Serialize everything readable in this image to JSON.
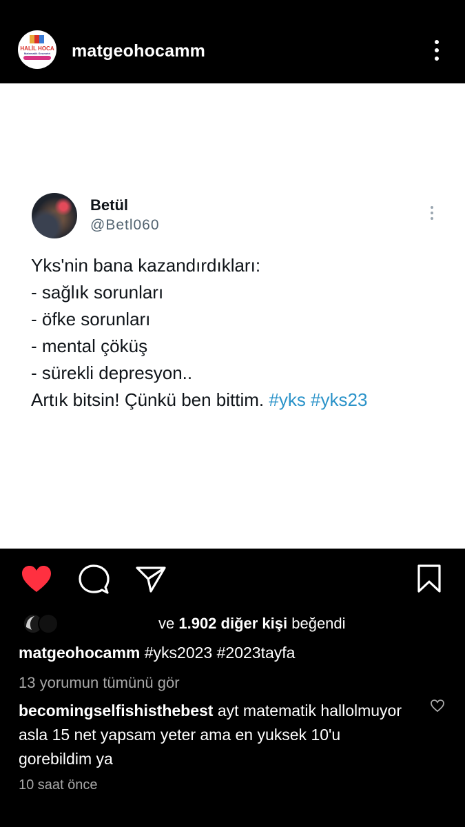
{
  "header": {
    "username": "matgeohocamm",
    "avatar_text_main": "HALİL HOCA",
    "avatar_text_sub": "Matematik Geometri"
  },
  "tweet": {
    "name": "Betül",
    "handle": "@Betl060",
    "lines": [
      "Yks'nin bana kazandırdıkları:",
      "- sağlık sorunları",
      "- öfke sorunları",
      "- mental çöküş",
      "- sürekli depresyon..",
      "Artık bitsin! Çünkü ben bittim. "
    ],
    "hashtags": "#yks #yks23"
  },
  "actions": {
    "liked": true,
    "like_color": "#ff3040"
  },
  "likes": {
    "prefix": "ve ",
    "count": "1.902 diğer kişi",
    "suffix": " beğendi"
  },
  "caption": {
    "username": "matgeohocamm",
    "text": "#yks2023 #2023tayfa"
  },
  "view_all": "13 yorumun tümünü gör",
  "comment": {
    "username": "becomingselfishisthebest",
    "text": "ayt matematik hallolmuyor asla 15 net yapsam yeter ama en yuksek 10'u gorebildim ya"
  },
  "time": "10 saat önce"
}
